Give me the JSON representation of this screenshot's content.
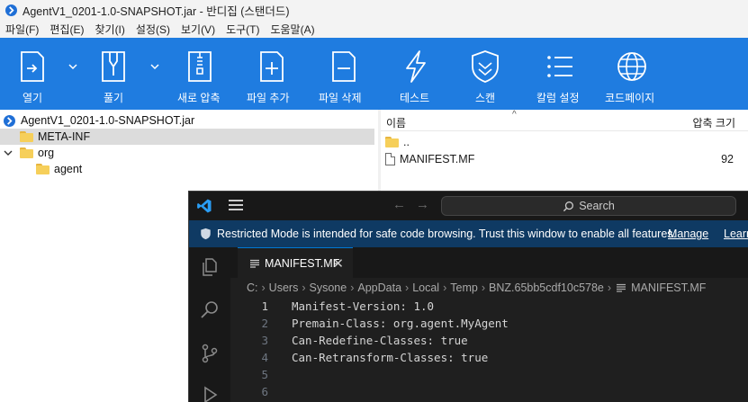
{
  "window": {
    "title": "AgentV1_0201-1.0-SNAPSHOT.jar - 반디집 (스탠더드)"
  },
  "menubar": {
    "items": [
      "파일(F)",
      "편집(E)",
      "찾기(I)",
      "설정(S)",
      "보기(V)",
      "도구(T)",
      "도움말(A)"
    ]
  },
  "toolbar": {
    "buttons": [
      "열기",
      "풀기",
      "새로 압축",
      "파일 추가",
      "파일 삭제",
      "테스트",
      "스캔",
      "칼럼 설정",
      "코드페이지"
    ]
  },
  "tree": {
    "root": "AgentV1_0201-1.0-SNAPSHOT.jar",
    "items": [
      "META-INF",
      "org",
      "agent"
    ]
  },
  "filelist": {
    "col_name": "이름",
    "col_size": "압축 크기",
    "rows": [
      {
        "name": "..",
        "size": ""
      },
      {
        "name": "MANIFEST.MF",
        "size": "92"
      }
    ]
  },
  "vscode": {
    "search": "Search",
    "banner": {
      "text": "Restricted Mode is intended for safe code browsing. Trust this window to enable all features.",
      "manage": "Manage",
      "learn": "Learn"
    },
    "tab": "MANIFEST.MF",
    "breadcrumbs": [
      "C:",
      "Users",
      "Sysone",
      "AppData",
      "Local",
      "Temp",
      "BNZ.65bb5cdf10c578e",
      "MANIFEST.MF"
    ],
    "lines": [
      {
        "n": "1",
        "text": "Manifest-Version: 1.0"
      },
      {
        "n": "2",
        "text": "Premain-Class: org.agent.MyAgent"
      },
      {
        "n": "3",
        "text": "Can-Redefine-Classes: true"
      },
      {
        "n": "4",
        "text": "Can-Retransform-Classes: true"
      },
      {
        "n": "5",
        "text": ""
      },
      {
        "n": "6",
        "text": ""
      }
    ]
  },
  "colors": {
    "toolbar": "#1f7ce0",
    "vscode_bg": "#1f1f1f",
    "banner": "#0f3a63",
    "folder": "#f6cf5a"
  }
}
